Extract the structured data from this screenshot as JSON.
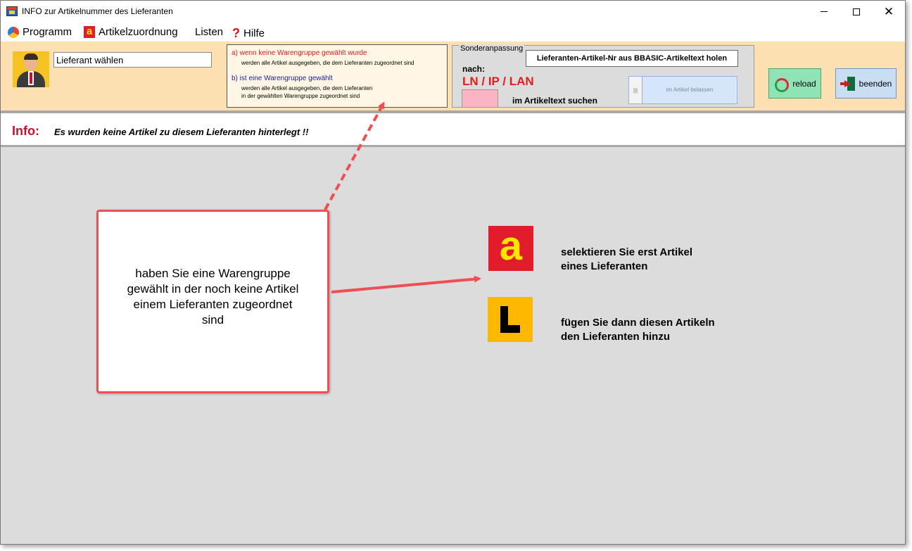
{
  "window": {
    "title": "INFO zur Artikelnummer des Lieferanten",
    "close_glyph": "✕"
  },
  "menu": {
    "items": [
      {
        "label": "Programm",
        "icon": "globe-icon"
      },
      {
        "label": "Artikelzuordnung",
        "icon": "a-icon"
      },
      {
        "label": "Listen"
      },
      {
        "label": "Hilfe",
        "icon": "question-icon"
      }
    ],
    "a_glyph": "a",
    "question_glyph": "?"
  },
  "toolbar": {
    "supplier_input_value": "Lieferant wählen",
    "hints": {
      "a_head": "a)  wenn keine Warengruppe gewählt wurde",
      "a_sub": "werden alle Artikel ausgegeben, die dem Lieferanten zugeordnet sind",
      "b_head": "b)  ist eine Warengruppe gewählt",
      "b_sub_1": "werden alle Artikel ausgegeben, die dem Lieferanten",
      "b_sub_2": "in der gewählten Warengruppe zugeordnet sind"
    },
    "sonder": {
      "legend": "Sonderanpassung",
      "fetch_button": "Lieferanten-Artikel-Nr aus BBASIC-Artikeltext holen",
      "nach": "nach:",
      "ln_ip_lan": "LN / IP / LAN",
      "suchen": "im Artikeltext suchen",
      "toggle_label": "im Artikel belassen",
      "toggle_handle": "|||"
    },
    "reload_label": "reload",
    "beenden_label": "beenden"
  },
  "info": {
    "label": "Info:",
    "text": "Es wurden keine  Artikel zu diesem Lieferanten hinterlegt !!"
  },
  "callout": {
    "text": "haben Sie eine Warengruppe gewählt in der noch keine Artikel einem Lieferanten zugeordnet sind"
  },
  "legend": {
    "a_glyph": "a",
    "a_line1": "selektieren Sie erst Artikel",
    "a_line2": "eines Lieferanten",
    "l_line1": "fügen Sie dann diesen Artikeln",
    "l_line2": "den Lieferanten hinzu"
  },
  "colors": {
    "toolbar_bg": "#fde0b2",
    "accent_red": "#e21d2b",
    "callout_border": "#ef4e55",
    "reload_bg": "#8fe3b4",
    "beenden_bg": "#c9ddf3",
    "content_bg": "#dcdcdc"
  }
}
